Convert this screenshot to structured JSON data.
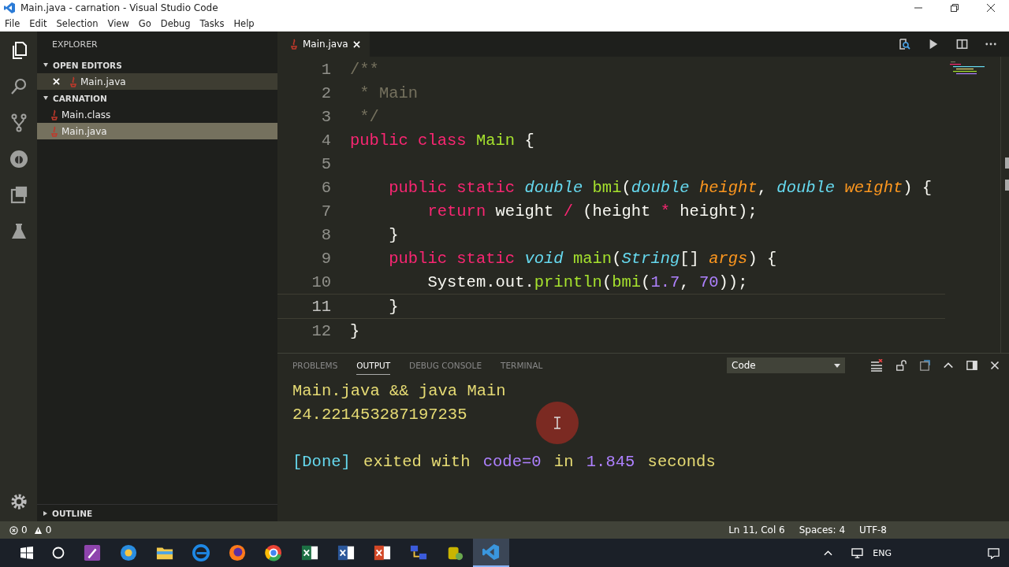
{
  "window": {
    "title": "Main.java - carnation - Visual Studio Code"
  },
  "menu": [
    "File",
    "Edit",
    "Selection",
    "View",
    "Go",
    "Debug",
    "Tasks",
    "Help"
  ],
  "activity_bar": [
    {
      "kind": "files",
      "selected": true
    },
    {
      "kind": "search",
      "selected": false
    },
    {
      "kind": "branch",
      "selected": false
    },
    {
      "kind": "debug",
      "selected": false
    },
    {
      "kind": "extensions",
      "selected": false
    },
    {
      "kind": "flask",
      "selected": false
    }
  ],
  "sidebar": {
    "title": "EXPLORER",
    "sections": [
      {
        "title": "OPEN EDITORS",
        "expanded": true,
        "items": [
          {
            "name": "Main.java",
            "closable": true,
            "selected": false,
            "hover": true
          }
        ]
      },
      {
        "title": "CARNATION",
        "expanded": true,
        "items": [
          {
            "name": "Main.class",
            "closable": false,
            "selected": false,
            "hover": false
          },
          {
            "name": "Main.java",
            "closable": false,
            "selected": true,
            "hover": false
          }
        ]
      }
    ],
    "outline": {
      "title": "OUTLINE",
      "expanded": false
    }
  },
  "editor": {
    "tabs": [
      {
        "label": "Main.java",
        "selected": true
      }
    ],
    "lines": [
      {
        "number": "1",
        "current": false,
        "tokens": [
          {
            "kind": "comment",
            "t": "/**"
          }
        ]
      },
      {
        "number": "2",
        "current": false,
        "tokens": [
          {
            "kind": "comment",
            "t": " * Main"
          }
        ]
      },
      {
        "number": "3",
        "current": false,
        "tokens": [
          {
            "kind": "comment",
            "t": " */"
          }
        ]
      },
      {
        "number": "4",
        "current": false,
        "tokens": [
          {
            "kind": "kw",
            "t": "public class "
          },
          {
            "kind": "cls",
            "t": "Main"
          },
          {
            "kind": "plain",
            "t": " {"
          }
        ]
      },
      {
        "number": "5",
        "current": false
      },
      {
        "number": "6",
        "current": false,
        "tokens": [
          {
            "kind": "kw",
            "t": "    public static "
          },
          {
            "kind": "type",
            "t": "double"
          },
          {
            "kind": "fn",
            "t": " bmi"
          },
          {
            "kind": "plain",
            "t": "("
          },
          {
            "kind": "type",
            "t": "double"
          },
          {
            "kind": "param",
            "t": " height"
          },
          {
            "kind": "plain",
            "t": ", "
          },
          {
            "kind": "type",
            "t": "double"
          },
          {
            "kind": "param",
            "t": " weight"
          },
          {
            "kind": "plain",
            "t": ") {"
          }
        ]
      },
      {
        "number": "7",
        "current": false,
        "tokens": [
          {
            "kind": "kw",
            "t": "        return"
          },
          {
            "kind": "plain",
            "t": " weight "
          },
          {
            "kind": "kw",
            "t": "/"
          },
          {
            "kind": "plain",
            "t": " (height "
          },
          {
            "kind": "kw",
            "t": "*"
          },
          {
            "kind": "plain",
            "t": " height);"
          }
        ]
      },
      {
        "number": "8",
        "current": false,
        "tokens": [
          {
            "kind": "plain",
            "t": "    }"
          }
        ]
      },
      {
        "number": "9",
        "current": false,
        "tokens": [
          {
            "kind": "kw",
            "t": "    public static "
          },
          {
            "kind": "type",
            "t": "void"
          },
          {
            "kind": "fn",
            "t": " main"
          },
          {
            "kind": "plain",
            "t": "("
          },
          {
            "kind": "type",
            "t": "String"
          },
          {
            "kind": "plain",
            "t": "[] "
          },
          {
            "kind": "param",
            "t": "args"
          },
          {
            "kind": "plain",
            "t": ") {"
          }
        ]
      },
      {
        "number": "10",
        "current": false,
        "tokens": [
          {
            "kind": "plain",
            "t": "        System.out."
          },
          {
            "kind": "fn",
            "t": "println"
          },
          {
            "kind": "plain",
            "t": "("
          },
          {
            "kind": "fn",
            "t": "bmi"
          },
          {
            "kind": "plain",
            "t": "("
          },
          {
            "kind": "num",
            "t": "1.7"
          },
          {
            "kind": "plain",
            "t": ", "
          },
          {
            "kind": "num",
            "t": "70"
          },
          {
            "kind": "plain",
            "t": "));"
          }
        ]
      },
      {
        "number": "11",
        "current": true,
        "tokens": [
          {
            "kind": "plain",
            "t": "    }"
          }
        ]
      },
      {
        "number": "12",
        "current": false,
        "tokens": [
          {
            "kind": "plain",
            "t": "}"
          }
        ]
      }
    ]
  },
  "panel": {
    "tabs": [
      {
        "label": "PROBLEMS",
        "selected": false
      },
      {
        "label": "OUTPUT",
        "selected": true
      },
      {
        "label": "DEBUG CONSOLE",
        "selected": false
      },
      {
        "label": "TERMINAL",
        "selected": false
      }
    ],
    "channel": "Code",
    "output": [
      {
        "kind": "log",
        "tokens": [
          {
            "kind": "yellow",
            "t": "Main.java && java Main"
          }
        ]
      },
      {
        "kind": "log",
        "tokens": [
          {
            "kind": "yellow",
            "t": "24.221453287197235"
          }
        ]
      },
      {
        "kind": "status",
        "tokens": [
          {
            "kind": "blue",
            "t": "[Done]"
          },
          {
            "kind": "yellow",
            "t": " exited with "
          },
          {
            "kind": "purple",
            "t": "code=0"
          },
          {
            "kind": "yellow",
            "t": " in "
          },
          {
            "kind": "purple",
            "t": "1.845"
          },
          {
            "kind": "yellow",
            "t": " seconds"
          }
        ]
      }
    ]
  },
  "status_bar": {
    "errors": "0",
    "warnings": "0",
    "position": "Ln 11, Col 6",
    "indent": "Spaces: 4",
    "encoding": "UTF-8"
  },
  "taskbar": {
    "apps": [
      {
        "kind": "pencil",
        "selected": false
      },
      {
        "kind": "compass",
        "selected": false
      },
      {
        "kind": "folder",
        "selected": false
      },
      {
        "kind": "browser",
        "selected": false
      },
      {
        "kind": "flame",
        "selected": false
      },
      {
        "kind": "ring",
        "selected": false
      },
      {
        "kind": "sheet",
        "selected": false
      },
      {
        "kind": "doc",
        "selected": false
      },
      {
        "kind": "slides",
        "selected": false
      },
      {
        "kind": "network",
        "selected": false
      },
      {
        "kind": "database",
        "selected": false
      },
      {
        "kind": "editor",
        "selected": true
      }
    ],
    "language": "ENG"
  }
}
